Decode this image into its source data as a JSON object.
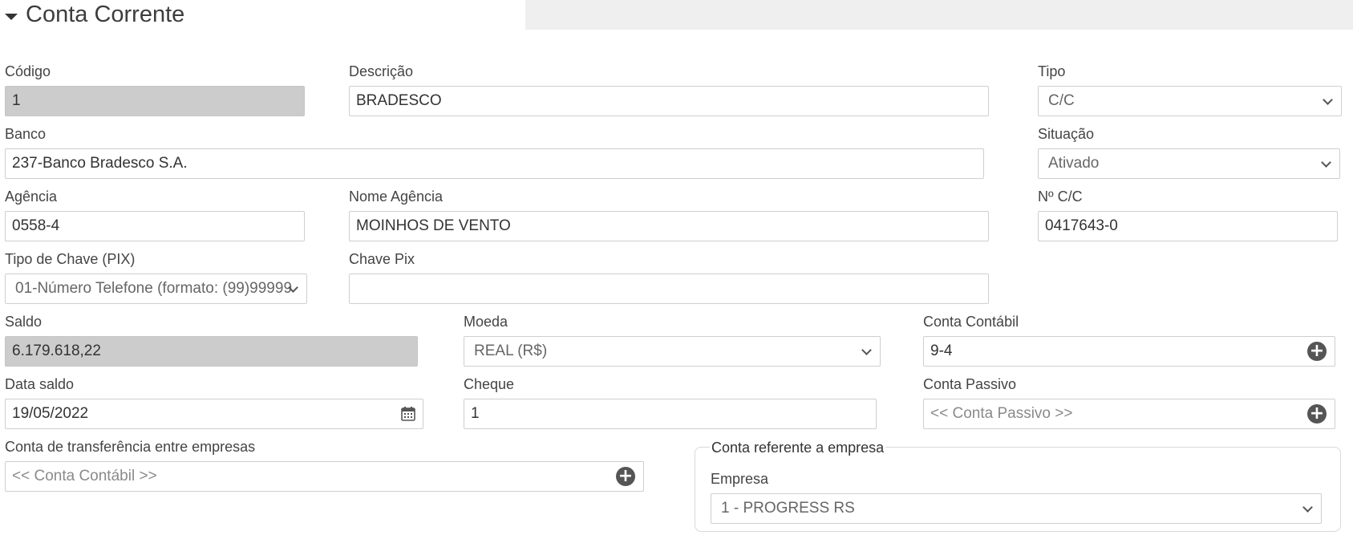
{
  "section": {
    "title": "Conta Corrente"
  },
  "fields": {
    "codigo": {
      "label": "Código",
      "value": "1"
    },
    "descricao": {
      "label": "Descrição",
      "value": "BRADESCO"
    },
    "tipo": {
      "label": "Tipo",
      "value": "C/C"
    },
    "banco": {
      "label": "Banco",
      "value": "237-Banco Bradesco S.A."
    },
    "situacao": {
      "label": "Situação",
      "value": "Ativado"
    },
    "agencia": {
      "label": "Agência",
      "value": "0558-4"
    },
    "nome_agencia": {
      "label": "Nome Agência",
      "value": "MOINHOS DE VENTO"
    },
    "numero_cc": {
      "label": "Nº C/C",
      "value": "0417643-0"
    },
    "tipo_chave_pix": {
      "label": "Tipo de Chave (PIX)",
      "value": "01-Número Telefone (formato: (99)99999"
    },
    "chave_pix": {
      "label": "Chave Pix",
      "value": ""
    },
    "saldo": {
      "label": "Saldo",
      "value": "6.179.618,22"
    },
    "moeda": {
      "label": "Moeda",
      "value": "REAL (R$)"
    },
    "conta_contabil": {
      "label": "Conta Contábil",
      "value": "9-4"
    },
    "data_saldo": {
      "label": "Data saldo",
      "value": "19/05/2022"
    },
    "cheque": {
      "label": "Cheque",
      "value": "1"
    },
    "conta_passivo": {
      "label": "Conta Passivo",
      "placeholder": "<< Conta Passivo >>"
    },
    "conta_transferencia": {
      "label": "Conta de transferência entre empresas",
      "placeholder": "<< Conta Contábil >>"
    }
  },
  "empresa_group": {
    "legend": "Conta referente a empresa",
    "empresa": {
      "label": "Empresa",
      "value": "1 - PROGRESS RS"
    }
  },
  "icons": {
    "add": "plus-circle-icon",
    "calendar": "calendar-icon",
    "dropdown": "chevron-down-icon",
    "collapse": "caret-down-icon"
  }
}
